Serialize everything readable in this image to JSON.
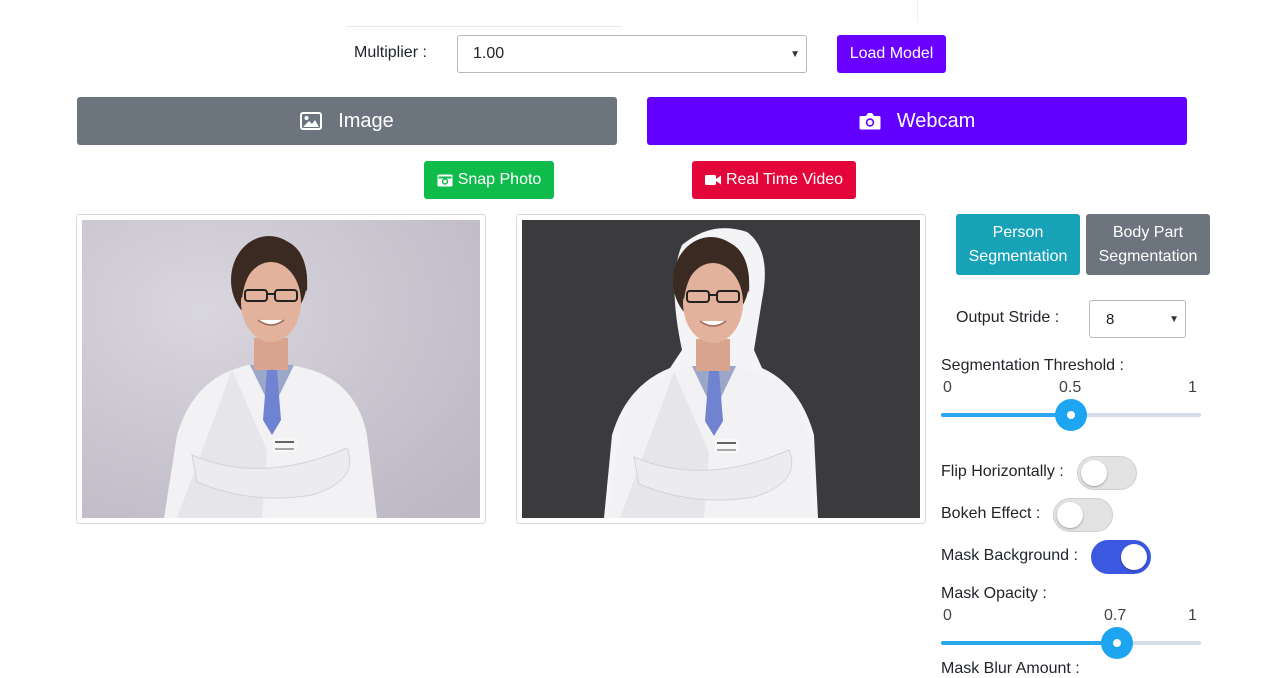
{
  "model": {
    "multiplier_label": "Multiplier :",
    "multiplier_value": "1.00",
    "load_label": "Load Model"
  },
  "tabs": {
    "image_label": "Image",
    "webcam_label": "Webcam"
  },
  "actions": {
    "snap_label": "Snap Photo",
    "realtime_label": "Real Time Video"
  },
  "segmentation": {
    "person_line1": "Person",
    "person_line2": "Segmentation",
    "body_line1": "Body Part",
    "body_line2": "Segmentation"
  },
  "controls": {
    "output_stride_label": "Output Stride :",
    "output_stride_value": "8",
    "threshold_label": "Segmentation Threshold :",
    "threshold_min": "0",
    "threshold_value": "0.5",
    "threshold_max": "1",
    "flip_label": "Flip Horizontally :",
    "flip_on": false,
    "bokeh_label": "Bokeh Effect :",
    "bokeh_on": false,
    "mask_bg_label": "Mask Background :",
    "mask_bg_on": true,
    "opacity_label": "Mask Opacity :",
    "opacity_min": "0",
    "opacity_value": "0.7",
    "opacity_max": "1",
    "next_label": "Mask Blur Amount :"
  },
  "colors": {
    "accent": "#6200ff",
    "info": "#17a2b8",
    "secondary": "#6c757d",
    "success": "#0fbb4a",
    "danger": "#e4063a",
    "slider": "#1ea5f2"
  },
  "icons": {
    "image_tab": "image-icon",
    "webcam_tab": "camera-icon",
    "snap": "camera-retro-icon",
    "realtime": "video-camera-icon"
  }
}
